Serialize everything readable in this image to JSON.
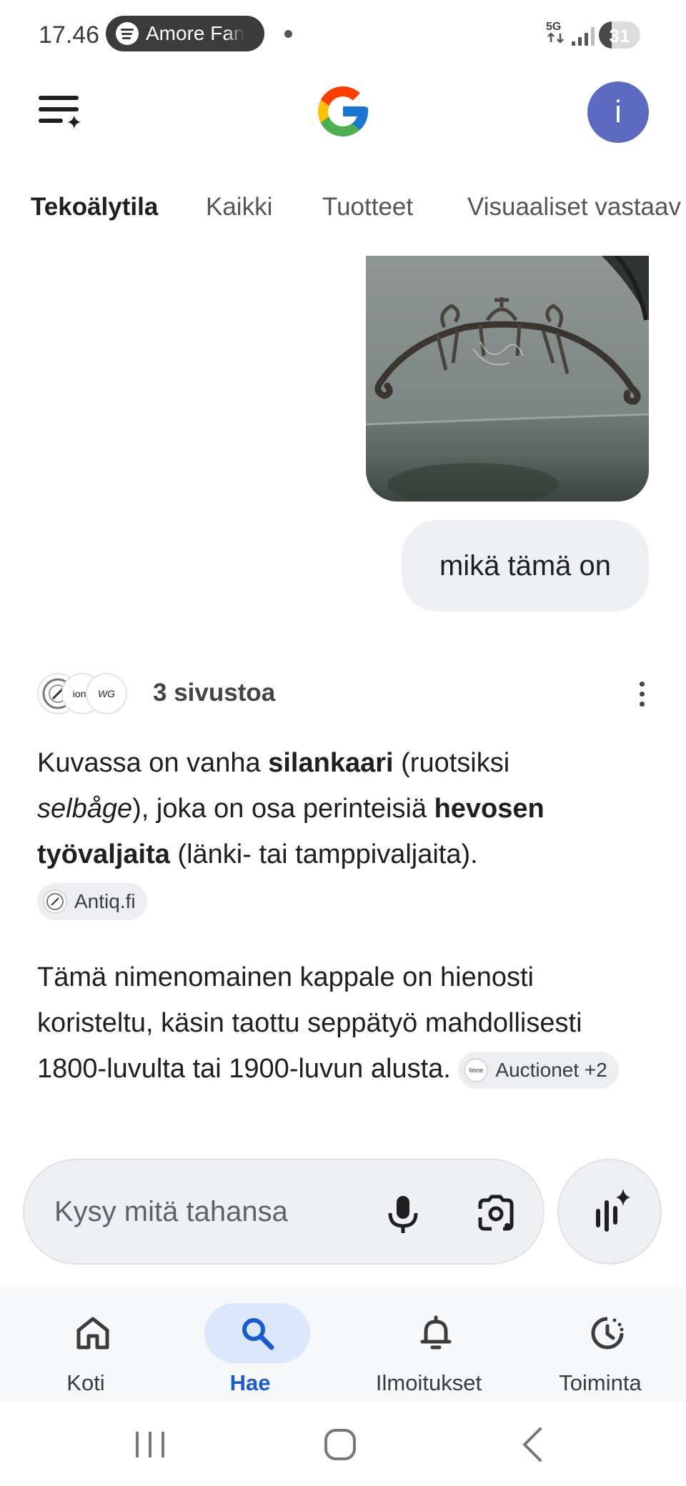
{
  "status_bar": {
    "time": "17.46",
    "media_title": "Amore Fan",
    "network": "5G",
    "battery": "31",
    "battery_level": 0.31
  },
  "header": {
    "logo": "google-g-logo",
    "avatar_initial": "i",
    "avatar_color": "#5c6bc0"
  },
  "tabs": [
    {
      "label": "Tekoälytila",
      "active": true
    },
    {
      "label": "Kaikki",
      "active": false
    },
    {
      "label": "Tuotteet",
      "active": false
    },
    {
      "label": "Visuaaliset vastaav",
      "active": false
    }
  ],
  "query": {
    "image": "uploaded-photo-horse-harness-bow",
    "text": "mikä tämä on"
  },
  "answer": {
    "sources_label": "3 sivustoa",
    "source_favicons": [
      "antiq-favicon",
      "auctionet-favicon",
      "monogram-favicon"
    ],
    "source_favicon_texts": [
      "",
      "ione",
      "WG"
    ],
    "para1": {
      "t1": "Kuvassa on vanha ",
      "b1": "silankaari",
      "t2": " (ruotsiksi ",
      "i1": "selbåge",
      "t3": "), joka on osa perinteisiä ",
      "b2": "hevosen työvaljaita",
      "t4": " (länki- tai tamppivaljaita).",
      "chip": "Antiq.fi"
    },
    "para2": {
      "text": "Tämä nimenomainen kappale on hienosti koristeltu, käsin taottu seppätyö mahdollisesti 1800-luvulta tai 1900-luvun alusta. ",
      "chip": "Auctionet +2",
      "chip_favicon_text": "tione"
    }
  },
  "input": {
    "placeholder": "Kysy mitä tahansa"
  },
  "bottom_nav": [
    {
      "label": "Koti",
      "icon": "home-icon",
      "active": false
    },
    {
      "label": "Hae",
      "icon": "search-icon",
      "active": true
    },
    {
      "label": "Ilmoitukset",
      "icon": "bell-icon",
      "active": false
    },
    {
      "label": "Toiminta",
      "icon": "activity-icon",
      "active": false
    }
  ],
  "colors": {
    "accent": "#1a5ccf",
    "active_pill": "#dde7fb",
    "bubble": "#eef0f3"
  }
}
